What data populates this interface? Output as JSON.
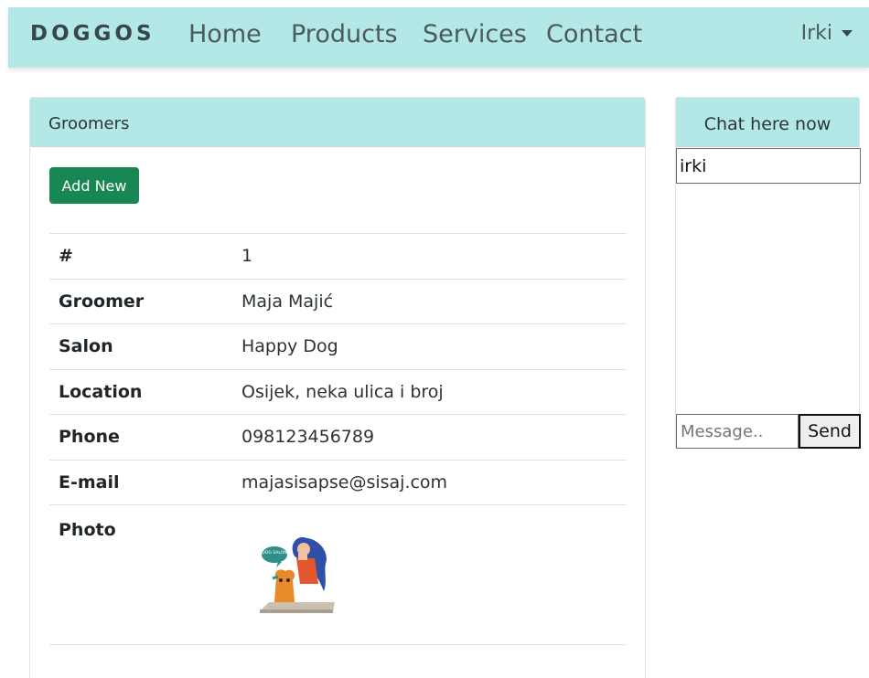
{
  "nav": {
    "brand": "DOGGOS",
    "links": [
      "Home",
      "Products",
      "Services",
      "Contact"
    ],
    "user": "Irki"
  },
  "groomers": {
    "header": "Groomers",
    "add_button": "Add New",
    "rows": [
      {
        "label": "#",
        "value": "1"
      },
      {
        "label": "Groomer",
        "value": "Maja Majić"
      },
      {
        "label": "Salon",
        "value": "Happy Dog"
      },
      {
        "label": "Location",
        "value": "Osijek, neka ulica i broj"
      },
      {
        "label": "Phone",
        "value": "098123456789"
      },
      {
        "label": "E-mail",
        "value": "majasisapse@sisaj.com"
      }
    ],
    "photo_label": "Photo",
    "photo_bubble": "DOG SALON"
  },
  "chat": {
    "header": "Chat here now",
    "current_user": "irki",
    "message_placeholder": "Message..",
    "send_label": "Send"
  },
  "colors": {
    "accent": "#b4e8e6",
    "add_button": "#198754"
  }
}
